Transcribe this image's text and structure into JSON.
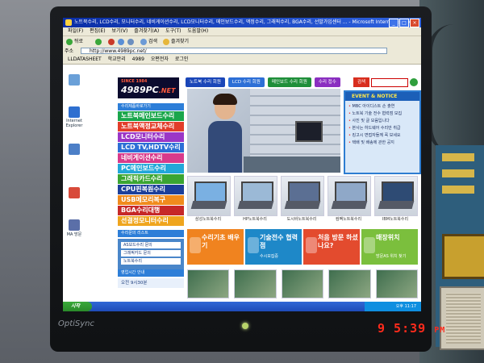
{
  "photo": {
    "timestamp": "9  5:39",
    "timestamp_ampm": "PM",
    "monitor_brand": "OptiSync"
  },
  "browser": {
    "title": "노트북수리, LCD수리, 모니터수리, 네비게이션수리, LCD모니터수리, 메인보드수리, 액정수리, 그래픽수리, BGA수리, 선발가입센터 ... - Microsoft Internet Explorer",
    "menu": [
      "파일(F)",
      "편집(E)",
      "보기(V)",
      "즐겨찾기(A)",
      "도구(T)",
      "도움말(H)"
    ],
    "toolbar": {
      "back": "뒤로",
      "search": "검색",
      "favorites": "즐겨찾기"
    },
    "address": "http://www.4989pc.net/",
    "links": [
      "LLDATASHEET",
      "학교안리",
      "4989",
      "오편전자",
      "로그인"
    ]
  },
  "desktop_icons": [
    "",
    "Internet Explorer",
    "",
    "",
    "MA 방문"
  ],
  "site": {
    "logo_since": "SINCE 1984",
    "logo_main": "4989PC",
    "logo_net": ".NET",
    "top_nav": [
      "노트북 수리 회원",
      "LCD 수리 회원",
      "메인보드 수리 회원",
      "수리 접수"
    ],
    "search_label": "검색",
    "left_menu_header": "수리제품바로가기",
    "left_menu": [
      {
        "label": "노트북메인보드수리",
        "color": "#19a64b"
      },
      {
        "label": "노트북액정교체수리",
        "color": "#e23d2a"
      },
      {
        "label": "LCD모니터수리",
        "color": "#9b36c6"
      },
      {
        "label": "LCD TV,HDTV수리",
        "color": "#2d6fd6"
      },
      {
        "label": "네비게이션수리",
        "color": "#d83a8b"
      },
      {
        "label": "PC메인보드수리",
        "color": "#22a7d9"
      },
      {
        "label": "그래픽카드수리",
        "color": "#3aa532"
      },
      {
        "label": "CPU핀복원수리",
        "color": "#1c3f9a"
      },
      {
        "label": "USB메모리복구",
        "color": "#f08b1d"
      },
      {
        "label": "BGA수리대행",
        "color": "#c62828"
      },
      {
        "label": "선결정모니터수리",
        "color": "#efa51e"
      }
    ],
    "left_sub_header": "수리문의 리스트",
    "left_board": [
      "AS보드수리 문의",
      "그래픽카드 문의",
      "노트북수리"
    ],
    "notice": {
      "title": "EVENT & NOTICE",
      "items": [
        "MBC 아이디스트 손 출연",
        "노트북 기술 전수 협력점 모집",
        "사진 및 글 모음입니다",
        "본사는 하드웨어 수리만 취급",
        "킹고시 면접자들께 꼭 보세요",
        "택배 및 배송에 관한 공지"
      ]
    },
    "products": [
      "삼성노트북수리",
      "HP노트북수리",
      "도시바노트북수리",
      "컴팩노트북수리",
      "IBM노트북수리"
    ],
    "banners": [
      {
        "title": "수리기초 배우기",
        "sub": "",
        "color": "#f0831f"
      },
      {
        "title": "기술전수 협력점",
        "sub": "수시모집중",
        "color": "#1e88c8"
      },
      {
        "title": "처음 방문 하셨나요?",
        "sub": "",
        "color": "#e34b2e"
      },
      {
        "title": "매장위치",
        "sub": "방문AS 위치 찾기",
        "color": "#7bbf3d"
      }
    ],
    "left_bottom_header": "영업시간 안내",
    "left_bottom_value": "오전 9시30분"
  },
  "taskbar": {
    "start": "시작",
    "clock": "오후 11:17"
  }
}
